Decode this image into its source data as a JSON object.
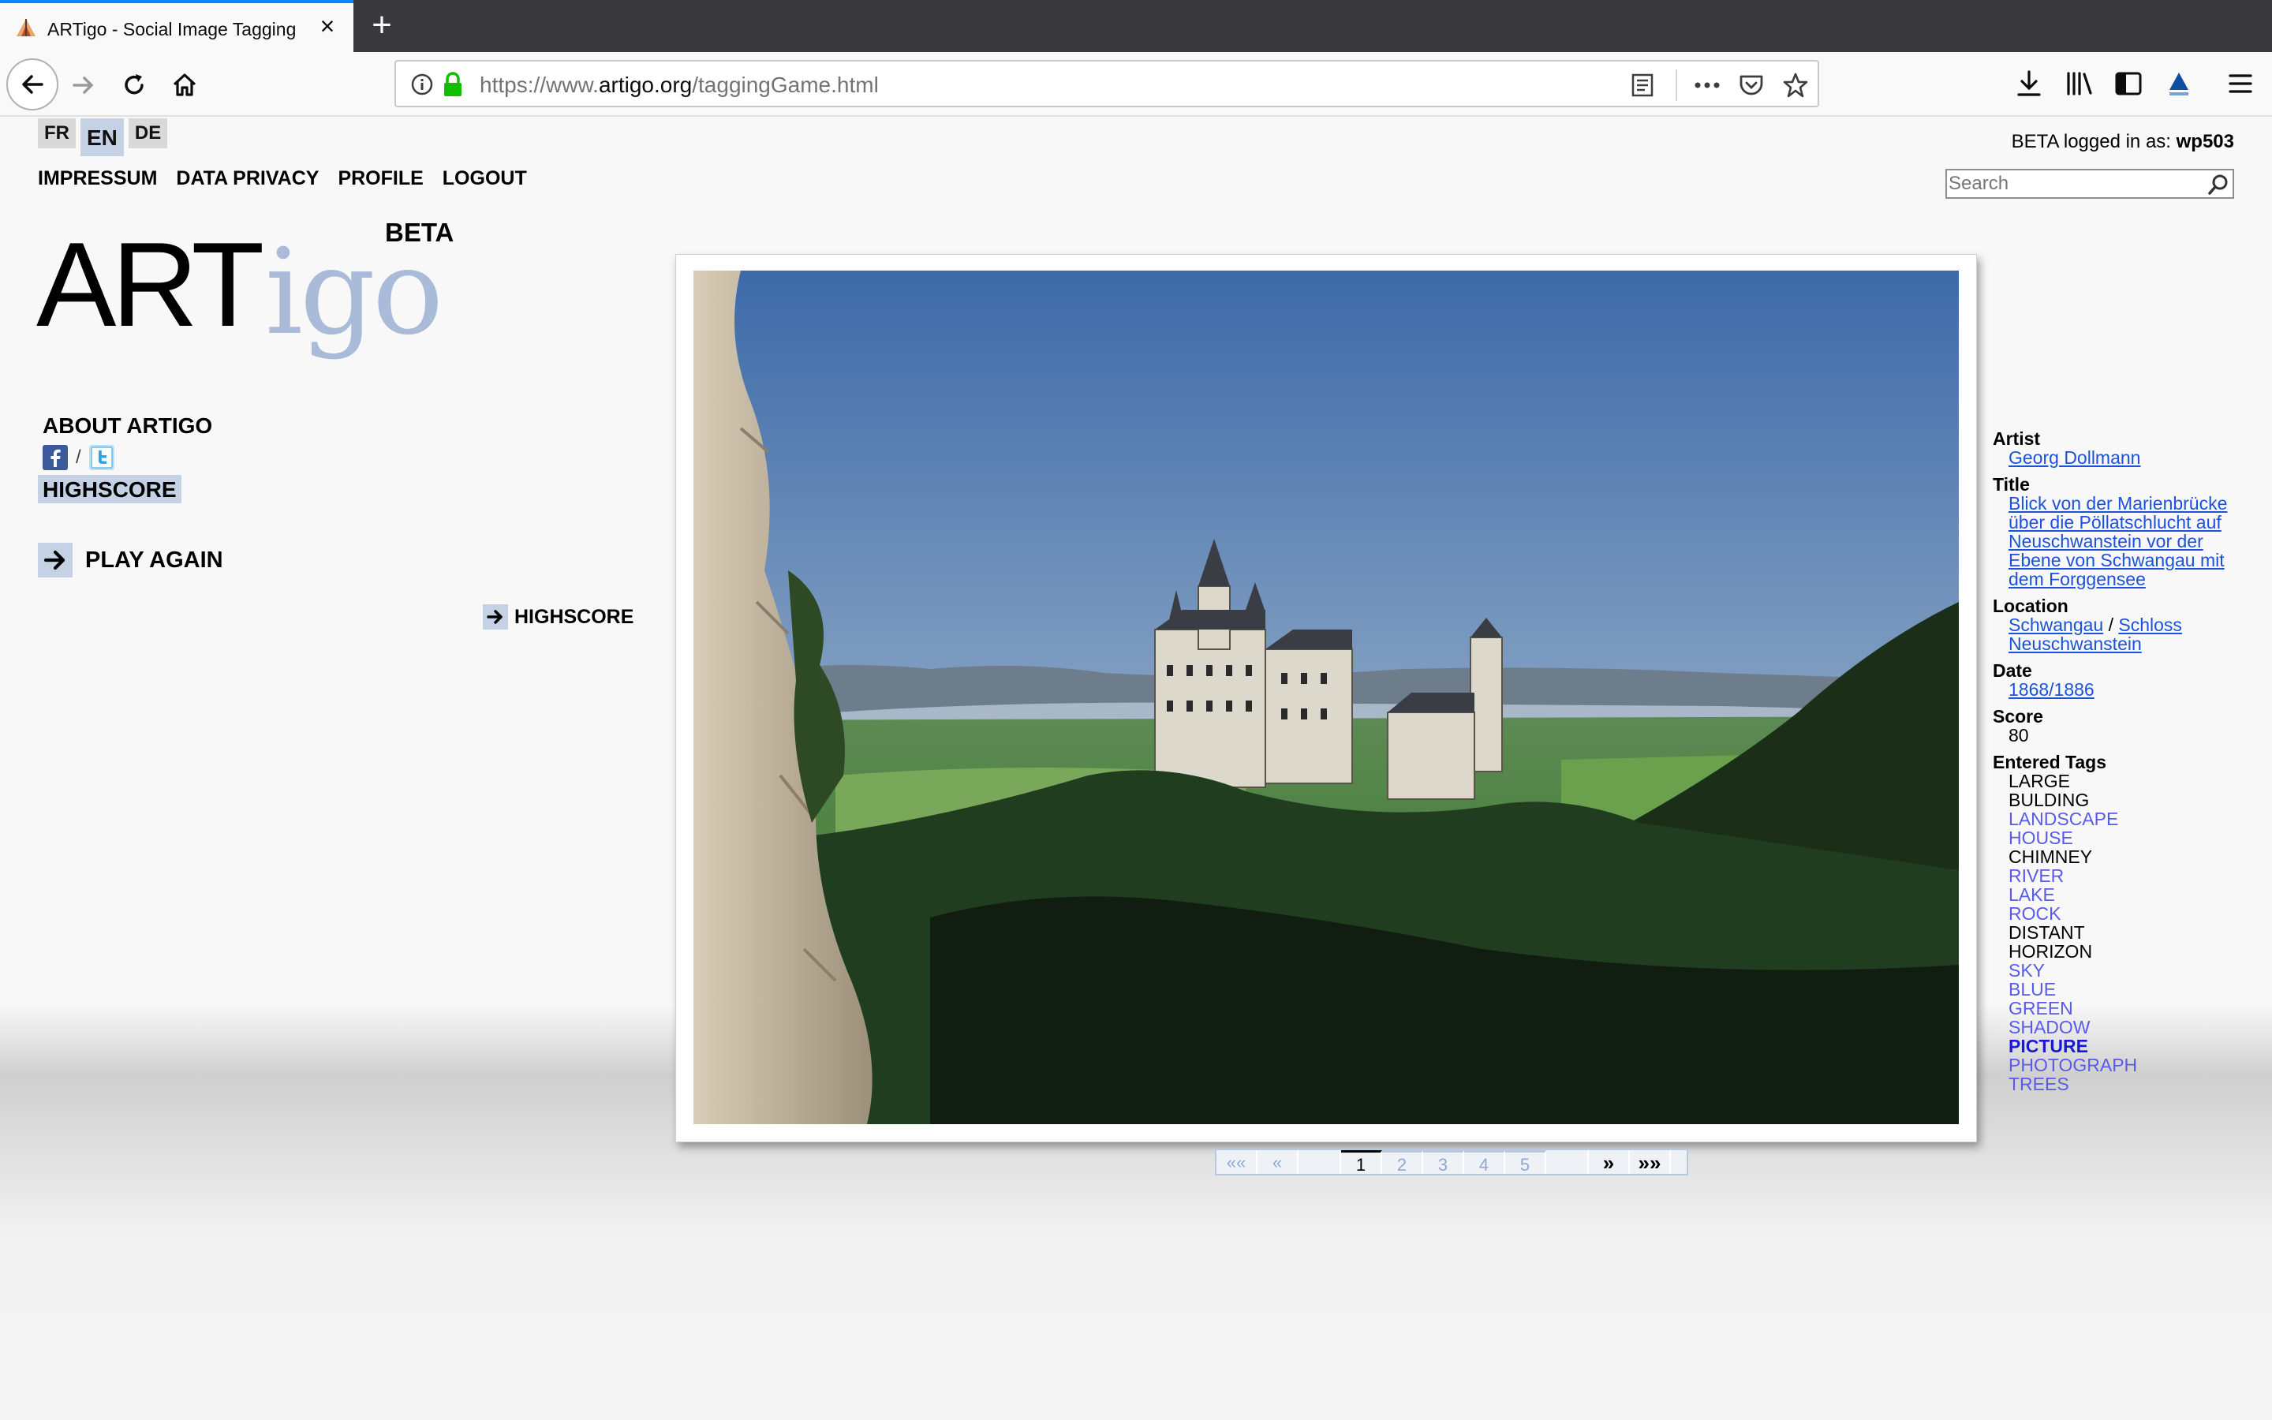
{
  "browser": {
    "tab_title": "ARTigo - Social Image Tagging",
    "url_prefix": "https://www.",
    "url_host": "artigo.org",
    "url_path": "/taggingGame.html"
  },
  "languages": [
    "FR",
    "EN",
    "DE"
  ],
  "active_language": "EN",
  "top_nav": [
    "IMPRESSUM",
    "DATA PRIVACY",
    "PROFILE",
    "LOGOUT"
  ],
  "login": {
    "prefix": "BETA logged in as: ",
    "user": "wp503"
  },
  "search": {
    "placeholder": "Search"
  },
  "logo": {
    "art": "ART",
    "igo": "igo",
    "beta": "BETA"
  },
  "sidebar": {
    "about": "ABOUT ARTIGO",
    "social_sep": "/",
    "highscore": "HIGHSCORE",
    "play_again": "PLAY AGAIN",
    "highscore_small": "HIGHSCORE"
  },
  "pagination": {
    "first": "««",
    "prev": "«",
    "pages": [
      "1",
      "2",
      "3",
      "4",
      "5"
    ],
    "current": "1",
    "next": "»",
    "last": "»»"
  },
  "info": {
    "artist_label": "Artist",
    "artist": "Georg Dollmann",
    "title_label": "Title",
    "title": "Blick von der Marienbrücke über die Pöllatschlucht auf Neuschwanstein vor der Ebene von Schwangau mit dem Forggensee",
    "location_label": "Location",
    "location_1": "Schwangau",
    "location_sep": " / ",
    "location_2": "Schloss Neuschwanstein",
    "date_label": "Date",
    "date": "1868/1886",
    "score_label": "Score",
    "score": "80",
    "tags_label": "Entered Tags",
    "tags": [
      {
        "text": "LARGE",
        "style": "black"
      },
      {
        "text": "BULDING",
        "style": "black"
      },
      {
        "text": "LANDSCAPE",
        "style": "blue"
      },
      {
        "text": "HOUSE",
        "style": "blue"
      },
      {
        "text": "CHIMNEY",
        "style": "black"
      },
      {
        "text": "RIVER",
        "style": "blue"
      },
      {
        "text": "LAKE",
        "style": "blue"
      },
      {
        "text": "ROCK",
        "style": "blue"
      },
      {
        "text": "DISTANT",
        "style": "black"
      },
      {
        "text": "HORIZON",
        "style": "black"
      },
      {
        "text": "SKY",
        "style": "blue"
      },
      {
        "text": "BLUE",
        "style": "blue"
      },
      {
        "text": "GREEN",
        "style": "blue"
      },
      {
        "text": "SHADOW",
        "style": "blue"
      },
      {
        "text": "PICTURE",
        "style": "bold"
      },
      {
        "text": "PHOTOGRAPH",
        "style": "blue"
      },
      {
        "text": "TREES",
        "style": "blue"
      }
    ]
  },
  "colors": {
    "accent_blue": "#c5d2e6",
    "logo_igo": "#a9bbd9",
    "link": "#1a52d9",
    "tag_blue": "#5a5ae8",
    "tag_bold": "#1818d8"
  }
}
